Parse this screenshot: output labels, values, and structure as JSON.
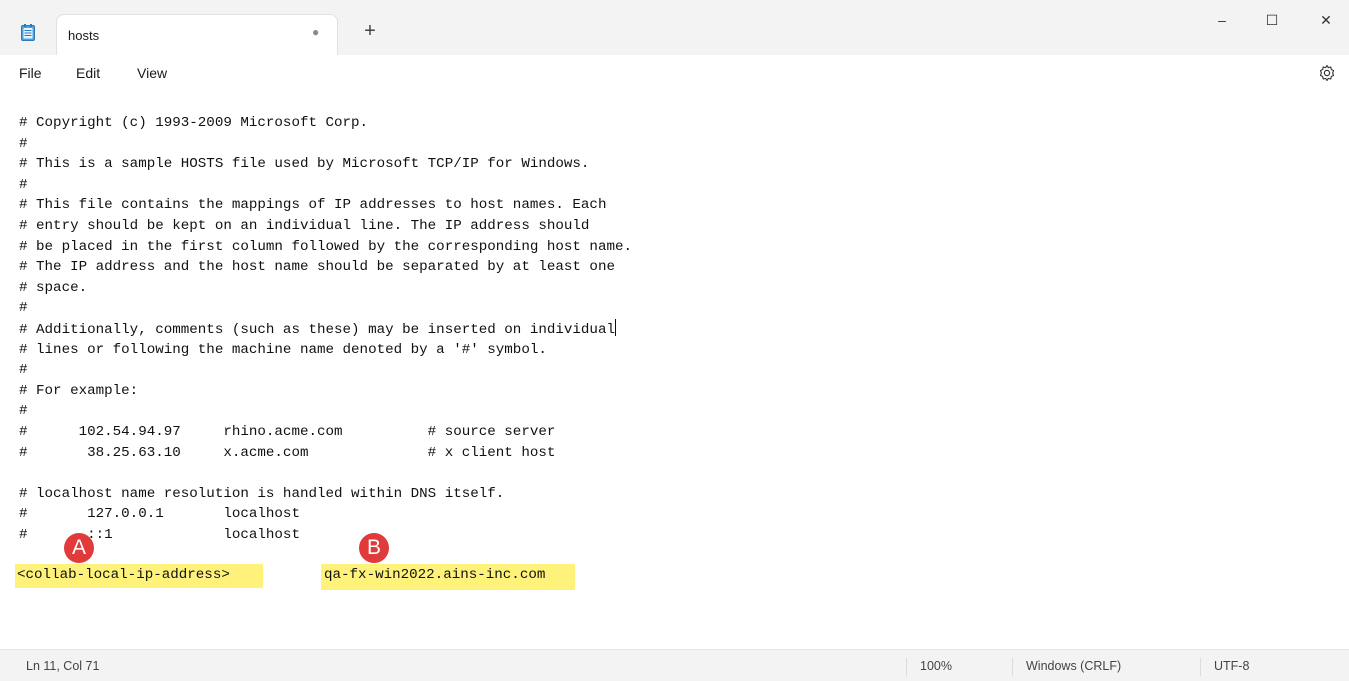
{
  "tab": {
    "title": "hosts",
    "modified_indicator": "●",
    "new_tab": "+"
  },
  "window": {
    "minimize": "–",
    "maximize": "☐",
    "close": "✕"
  },
  "menu": {
    "file": "File",
    "edit": "Edit",
    "view": "View"
  },
  "editor": {
    "lines": [
      "# Copyright (c) 1993-2009 Microsoft Corp.",
      "#",
      "# This is a sample HOSTS file used by Microsoft TCP/IP for Windows.",
      "#",
      "# This file contains the mappings of IP addresses to host names. Each",
      "# entry should be kept on an individual line. The IP address should",
      "# be placed in the first column followed by the corresponding host name.",
      "# The IP address and the host name should be separated by at least one",
      "# space.",
      "#",
      "# Additionally, comments (such as these) may be inserted on individual",
      "# lines or following the machine name denoted by a '#' symbol.",
      "#",
      "# For example:",
      "#",
      "#      102.54.94.97     rhino.acme.com          # source server",
      "#       38.25.63.10     x.acme.com              # x client host",
      "",
      "# localhost name resolution is handled within DNS itself.",
      "#       127.0.0.1       localhost",
      "#       ::1             localhost"
    ],
    "entry_ip": "<collab-local-ip-address>",
    "entry_host": "qa-fx-win2022.ains-inc.com"
  },
  "annotations": {
    "a": "A",
    "b": "B"
  },
  "status": {
    "position": "Ln 11, Col 71",
    "zoom": "100%",
    "line_ending": "Windows (CRLF)",
    "encoding": "UTF-8"
  },
  "colors": {
    "highlight": "#fff27a",
    "badge": "#e03a3a"
  }
}
